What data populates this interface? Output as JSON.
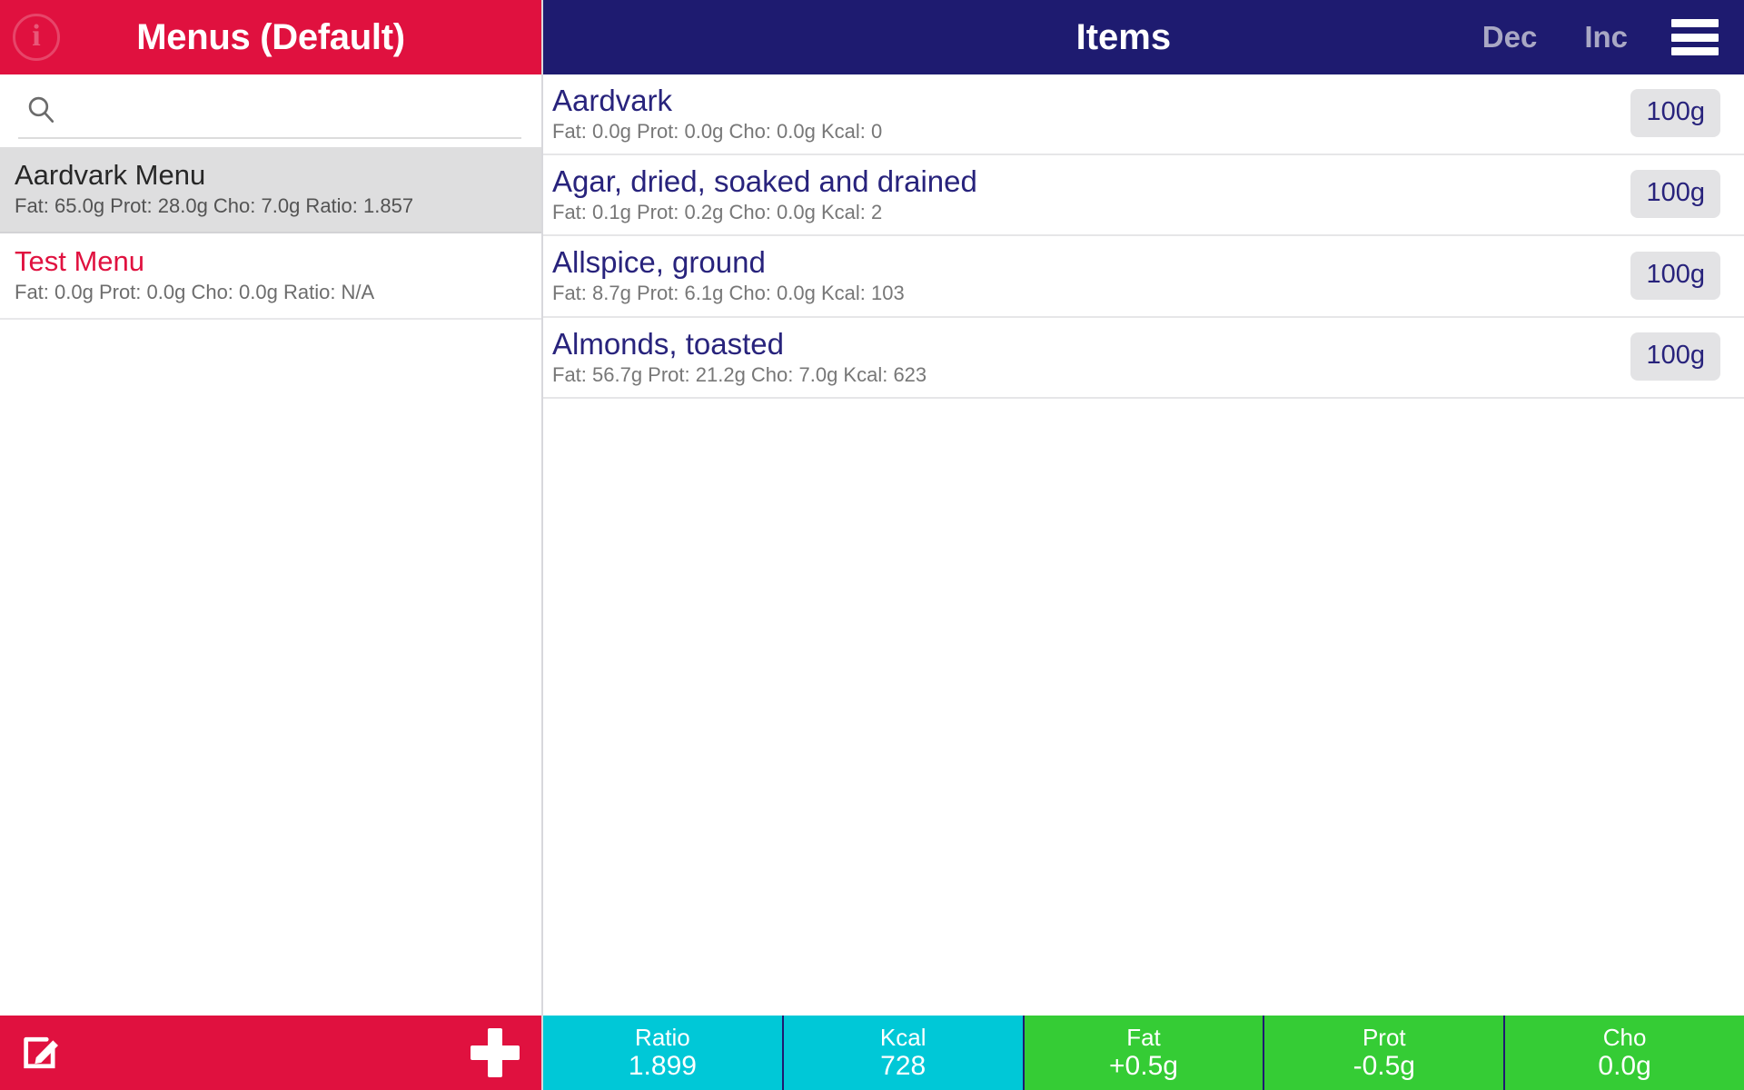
{
  "colors": {
    "accent_red": "#e0113f",
    "navy": "#1e1b70",
    "cyan": "#00c8d7",
    "green": "#35cc35",
    "selected_row": "#dededf",
    "badge_bg": "#e3e3e5"
  },
  "left_panel": {
    "header": {
      "title": "Menus (Default)",
      "info_icon_glyph": "i",
      "info_icon_name": "info-icon"
    },
    "search": {
      "value": "",
      "placeholder": "",
      "icon_name": "search-icon"
    },
    "menus": [
      {
        "title": "Aardvark Menu",
        "subtitle": "Fat: 65.0g Prot: 28.0g Cho: 7.0g Ratio: 1.857",
        "selected": true,
        "accent": false
      },
      {
        "title": "Test Menu",
        "subtitle": "Fat: 0.0g Prot: 0.0g Cho: 0.0g Ratio: N/A",
        "selected": false,
        "accent": true
      }
    ],
    "footer": {
      "edit_icon_name": "edit-icon",
      "add_icon_name": "plus-icon"
    }
  },
  "right_panel": {
    "header": {
      "title": "Items",
      "dec_label": "Dec",
      "inc_label": "Inc",
      "menu_icon_name": "hamburger-menu-icon"
    },
    "items": [
      {
        "title": "Aardvark",
        "subtitle": "Fat: 0.0g Prot: 0.0g Cho: 0.0g Kcal: 0",
        "amount": "100g"
      },
      {
        "title": "Agar, dried, soaked and drained",
        "subtitle": "Fat: 0.1g Prot: 0.2g Cho: 0.0g Kcal: 2",
        "amount": "100g"
      },
      {
        "title": "Allspice, ground",
        "subtitle": "Fat: 8.7g Prot: 6.1g Cho: 0.0g Kcal: 103",
        "amount": "100g"
      },
      {
        "title": "Almonds, toasted",
        "subtitle": "Fat: 56.7g Prot: 21.2g Cho: 7.0g Kcal: 623",
        "amount": "100g"
      }
    ],
    "status_bar": [
      {
        "label": "Ratio",
        "value": "1.899",
        "color": "#00c8d7"
      },
      {
        "label": "Kcal",
        "value": "728",
        "color": "#00c8d7"
      },
      {
        "label": "Fat",
        "value": "+0.5g",
        "color": "#35cc35"
      },
      {
        "label": "Prot",
        "value": "-0.5g",
        "color": "#35cc35"
      },
      {
        "label": "Cho",
        "value": "0.0g",
        "color": "#35cc35"
      }
    ]
  }
}
